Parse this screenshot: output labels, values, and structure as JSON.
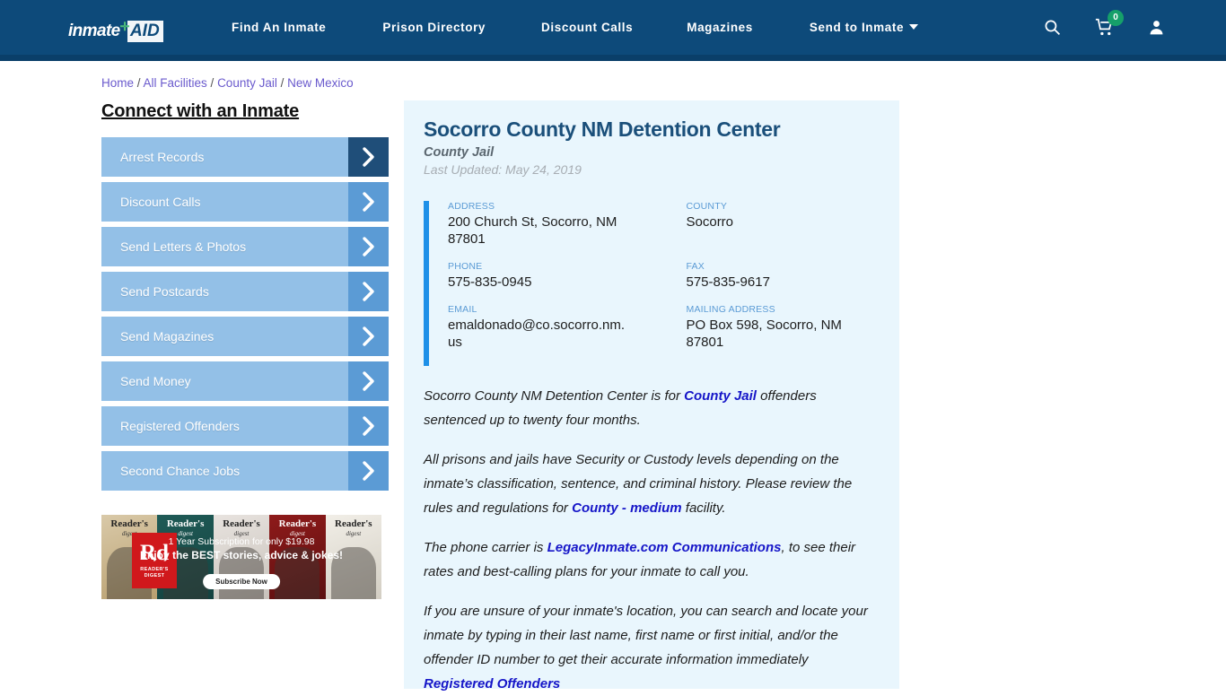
{
  "header": {
    "logo": {
      "part1": "inmate",
      "plus": "✛",
      "part2": "AID"
    },
    "nav": [
      {
        "label": "Find An Inmate",
        "name": "nav-find-an-inmate"
      },
      {
        "label": "Prison Directory",
        "name": "nav-prison-directory"
      },
      {
        "label": "Discount Calls",
        "name": "nav-discount-calls"
      },
      {
        "label": "Magazines",
        "name": "nav-magazines"
      },
      {
        "label": "Send to Inmate",
        "name": "nav-send-to-inmate",
        "dropdown": true
      }
    ],
    "cart_count": "0",
    "colors": {
      "background": "#0d4a7a",
      "badge": "#16a06a",
      "logo_plus": "#4fbf7a"
    }
  },
  "breadcrumb": {
    "items": [
      "Home",
      "All Facilities",
      "County Jail",
      "New Mexico"
    ],
    "separator": "/"
  },
  "sidebar": {
    "title": "Connect with an Inmate",
    "items": [
      {
        "label": "Arrest Records",
        "active": true
      },
      {
        "label": "Discount Calls",
        "active": false
      },
      {
        "label": "Send Letters & Photos",
        "active": false
      },
      {
        "label": "Send Postcards",
        "active": false
      },
      {
        "label": "Send Magazines",
        "active": false
      },
      {
        "label": "Send Money",
        "active": false
      },
      {
        "label": "Registered Offenders",
        "active": false
      },
      {
        "label": "Second Chance Jobs",
        "active": false
      }
    ],
    "colors": {
      "button": "#93c0e7",
      "arrow": "#5b9bd5",
      "arrow_active": "#1f4e79"
    }
  },
  "ad": {
    "brand": "Rd",
    "brand_sub": "READER'S DIGEST",
    "line1": "1 Year Subscription for only $19.98",
    "line2": "Enjoy the BEST stories, advice & jokes!",
    "cta": "Subscribe Now",
    "covers": [
      {
        "title": "Reader's",
        "sub": "digest"
      },
      {
        "title": "Reader's",
        "sub": "digest"
      },
      {
        "title": "Reader's",
        "sub": "digest"
      },
      {
        "title": "Reader's",
        "sub": "digest"
      },
      {
        "title": "Reader's",
        "sub": "digest"
      }
    ]
  },
  "facility": {
    "title": "Socorro County NM Detention Center",
    "type": "County Jail",
    "last_updated": "Last Updated: May 24, 2019",
    "info": [
      {
        "label": "ADDRESS",
        "value": "200 Church St, Socorro, NM 87801"
      },
      {
        "label": "COUNTY",
        "value": "Socorro"
      },
      {
        "label": "PHONE",
        "value": "575-835-0945"
      },
      {
        "label": "FAX",
        "value": "575-835-9617"
      },
      {
        "label": "EMAIL",
        "value": "emaldonado@co.socorro.nm.us"
      },
      {
        "label": "MAILING ADDRESS",
        "value": "PO Box 598, Socorro, NM 87801"
      }
    ],
    "accent_color": "#1e90e8"
  },
  "paragraphs": {
    "p1_a": "Socorro County NM Detention Center is for ",
    "p1_link": "County Jail",
    "p1_b": " offenders sentenced up to twenty four months.",
    "p2_a": "All prisons and jails have Security or Custody levels depending on the inmate’s classification, sentence, and criminal history. Please review the rules and regulations for ",
    "p2_link": "County - medium",
    "p2_b": " facility.",
    "p3_a": "The phone carrier is ",
    "p3_link": "LegacyInmate.com Communications",
    "p3_b": ", to see their rates and best-calling plans for your inmate to call you.",
    "p4_a": "If you are unsure of your inmate's location, you can search and locate your inmate by typing in their last name, first name or first initial, and/or the offender ID number to get their accurate information immediately ",
    "p4_link": "Registered Offenders"
  }
}
